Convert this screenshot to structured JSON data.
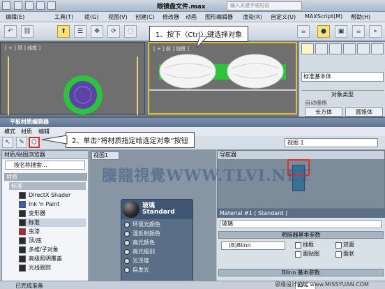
{
  "main_window": {
    "title": "眼镜盘文件.max",
    "search_placeholder": "输入关键字或短语",
    "menu": [
      "编辑(E)",
      "工具(T)",
      "组(G)",
      "视图(V)",
      "创建(C)",
      "修改器",
      "动画",
      "图形编辑器",
      "渲染(R)",
      "自定义(U)",
      "MAXScript(M)",
      "帮助(H)"
    ],
    "viewports": {
      "left_label": "[ + ] 顶 ] 线框 ]",
      "right_label": "[ + ] 前 ] 线框 ]"
    },
    "command_panel": {
      "object_type_dropdown": "标准基本体",
      "section_title": "对象类型",
      "autogrid_label": "自动栅格",
      "buttons": [
        "长方体",
        "圆锥体"
      ]
    }
  },
  "callouts": {
    "step1": "1、按下〈Ctrl〉键选择对象",
    "step2": "2、单击“将材质指定给选定对象”按钮"
  },
  "slate_editor": {
    "title": "平板材质编辑器",
    "menu": [
      "模式",
      "材质",
      "编辑"
    ],
    "view_dropdown": "视图 1",
    "browser": {
      "header": "材质/贴图浏览器",
      "search_placeholder": "按名称搜索...",
      "group_label": "材质",
      "subgroup_label": "标准",
      "items": [
        "DirectX Shader",
        "Ink 'n Paint",
        "变形器",
        "标准",
        "虫漆",
        "顶/底",
        "多维/子对象",
        "高级照明覆盖",
        "光线跟踪"
      ]
    },
    "view_tab": "视图1",
    "node": {
      "title": "玻璃",
      "subtitle": "Standard",
      "slots": [
        "环境光颜色",
        "漫反射颜色",
        "高光颜色",
        "高光级别",
        "光泽度",
        "自发光"
      ]
    },
    "navigator_header": "导航器",
    "properties": {
      "title": "Material #1 ( Standard )",
      "name_value": "玻璃",
      "rollout_shader": "明暗器基本参数",
      "shader": "(B)Blinn",
      "checkboxes": [
        "线框",
        "双面",
        "面贴图",
        "面状"
      ],
      "rollout_blinn": "Blinn 基本参数"
    },
    "status": "已完成准备",
    "zoom": "83%",
    "watermark_main": "騰龍視覺WWW.TLVI.NET",
    "watermark_foot": "思缘设计论坛 www.MISSYUAN.COM"
  }
}
